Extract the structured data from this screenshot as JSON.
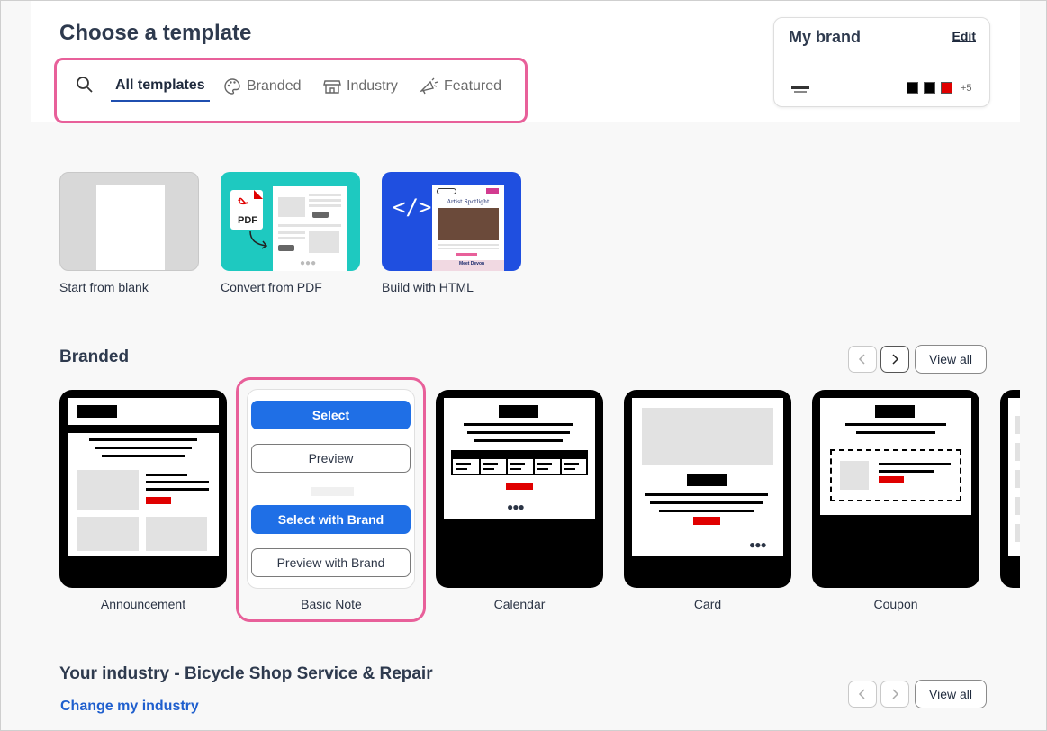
{
  "header": {
    "title": "Choose a template",
    "tabs": [
      {
        "label": "All templates",
        "icon": "search-icon",
        "active": true
      },
      {
        "label": "Branded",
        "icon": "palette-icon"
      },
      {
        "label": "Industry",
        "icon": "storefront-icon"
      },
      {
        "label": "Featured",
        "icon": "megaphone-icon"
      }
    ]
  },
  "brand": {
    "title": "My brand",
    "edit_label": "Edit",
    "colors": [
      "#000000",
      "#000000",
      "#e00000"
    ],
    "more_colors": "+5"
  },
  "start_options": [
    {
      "label": "Start from blank"
    },
    {
      "label": "Convert from PDF",
      "badge": "PDF"
    },
    {
      "label": "Build with HTML",
      "preview_heading": "Artist Spotlight",
      "preview_sub": "Meet Devon"
    }
  ],
  "branded": {
    "title": "Branded",
    "view_all": "View all",
    "templates": [
      {
        "label": "Announcement"
      },
      {
        "label": "Basic Note"
      },
      {
        "label": "Calendar"
      },
      {
        "label": "Card"
      },
      {
        "label": "Coupon"
      }
    ],
    "hover_actions": {
      "select": "Select",
      "preview": "Preview",
      "select_brand": "Select with Brand",
      "preview_brand": "Preview with Brand"
    }
  },
  "industry": {
    "title": "Your industry - Bicycle Shop Service & Repair",
    "change_link": "Change my industry",
    "view_all": "View all"
  },
  "colors": {
    "accent_blue": "#1f6fe6",
    "highlight_pink": "#e8609a",
    "pdf_teal": "#1ec9c0",
    "html_blue": "#1f4fe0"
  }
}
